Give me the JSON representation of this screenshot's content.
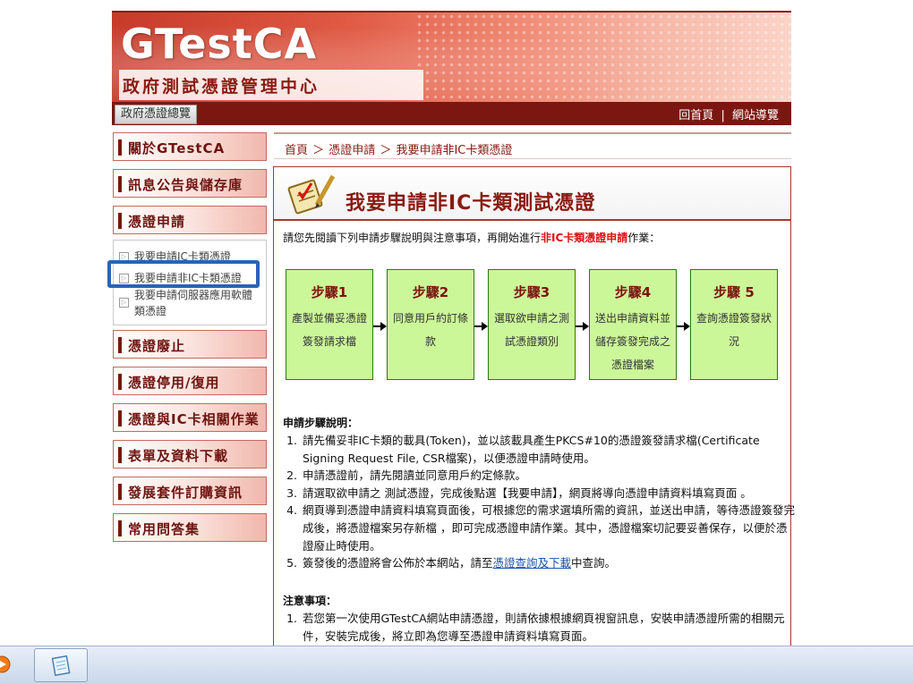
{
  "header": {
    "logo": "GTestCA",
    "subtitle": "政府測試憑證管理中心",
    "overview_button": "政府憑證總覽",
    "links": [
      "回首頁",
      "網站導覽"
    ],
    "separator": "|"
  },
  "sidebar": {
    "items": [
      {
        "label": "關於GTestCA"
      },
      {
        "label": "訊息公告與儲存庫"
      },
      {
        "label": "憑證申請"
      },
      {
        "label": "憑證廢止"
      },
      {
        "label": "憑證停用/復用"
      },
      {
        "label": "憑證與IC卡相關作業"
      },
      {
        "label": "表單及資料下載"
      },
      {
        "label": "發展套件訂購資訊"
      },
      {
        "label": "常用問答集"
      }
    ],
    "submenu": [
      {
        "label": "我要申請IC卡類憑證"
      },
      {
        "label": "我要申請非IC卡類憑證"
      },
      {
        "label": "我要申請伺服器應用軟體類憑證"
      }
    ]
  },
  "breadcrumb": {
    "home": "首頁",
    "sep": "＞",
    "level1": "憑證申請",
    "level2": "我要申請非IC卡類憑證"
  },
  "content": {
    "title": "我要申請非IC卡類測試憑證",
    "intro_before": "請您先閱讀下列申請步驟說明與注意事項，再開始進行",
    "intro_highlight": "非IC卡類憑證申請",
    "intro_after": "作業：",
    "steps": [
      {
        "title": "步驟1",
        "desc": "產製並備妥憑證簽發請求檔"
      },
      {
        "title": "步驟2",
        "desc": "同意用戶約訂條款"
      },
      {
        "title": "步驟3",
        "desc": "選取欲申請之測試憑證類別"
      },
      {
        "title": "步驟4",
        "desc": "送出申請資料並儲存簽發完成之憑證檔案"
      },
      {
        "title": "步驟 5",
        "desc": "查詢憑證簽發狀況"
      }
    ],
    "steps_heading": "申請步驟說明：",
    "step_notes": [
      "請先備妥非IC卡類的載具(Token)，並以該載具產生PKCS#10的憑證簽發請求檔(Certificate Signing Request File, CSR檔案)，以便憑證申請時使用。",
      "申請憑證前，請先閱讀並同意用戶約定條款。",
      "請選取欲申請之 測試憑證，完成後點選【我要申請】，網頁將導向憑證申請資料填寫頁面 。",
      "網頁導到憑證申請資料填寫頁面後，可根據您的需求選填所需的資訊，並送出申請，等待憑證簽發完成後，將憑證檔案另存新檔 ，即可完成憑證申請作業。其中，憑證檔案切記要妥善保存，以便於憑證廢止時使用。"
    ],
    "step5_before": "簽發後的憑證將會公佈於本網站，請至",
    "step5_link": "憑證查詢及下載",
    "step5_after": "中查詢。",
    "notes_heading": "注意事項：",
    "notes": [
      "若您第一次使用GTestCA網站申請憑證，則請依據根據網頁視窗訊息，安裝申請憑證所需的相關元件，安裝完成後，將立即為您導至憑證申請資料填寫頁面。"
    ]
  },
  "colors": {
    "brand_red": "#8b1a12",
    "step_green": "#ccf799",
    "highlight_blue": "#2b63b7",
    "link_blue": "#1a55a8"
  },
  "taskbar": {
    "icons": [
      "media-player-icon",
      "notepad-icon"
    ]
  }
}
